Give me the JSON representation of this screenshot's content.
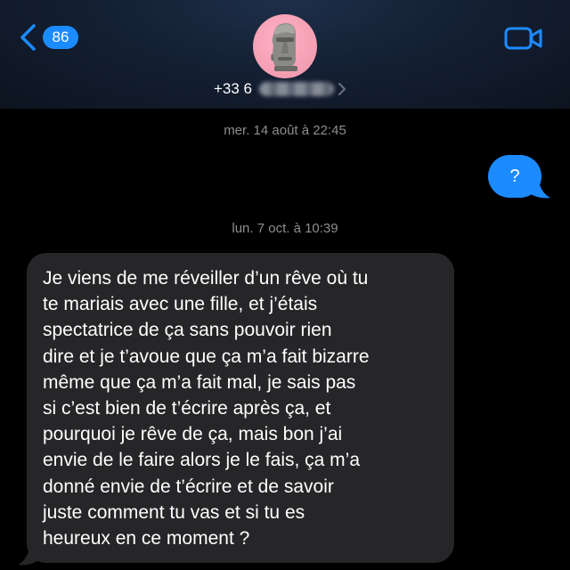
{
  "header": {
    "back_count": "86",
    "contact_number_prefix": "+33 6",
    "avatar": "moai-emoji-avatar",
    "video_icon": "video-camera-icon",
    "colors": {
      "accent": "#1c8bff",
      "header_bg": "#142033",
      "avatar_bg": "#f5a0b4"
    }
  },
  "conversation": {
    "timestamp_1": "mer. 14 août à 22:45",
    "sent_message": "?",
    "timestamp_2": "lun. 7 oct. à 10:39",
    "received_lines": [
      "Je viens de me réveiller d’un rêve où tu",
      "te mariais avec une fille, et j’étais",
      "spectatrice de ça sans pouvoir rien",
      "dire et je t’avoue que ça m’a fait bizarre",
      "même que ça m’a fait mal, je sais pas",
      "si c’est bien de t’écrire après ça, et",
      "pourquoi je rêve de ça, mais bon j’ai",
      "envie de le faire alors je le fais, ça m’a",
      "donné envie de t’écrire et de savoir",
      "juste comment tu vas et si tu es",
      "heureux en ce moment ?"
    ],
    "colors": {
      "sent_bubble": "#1c8bff",
      "received_bubble": "#262629",
      "timestamp_text": "#8e8e93"
    }
  }
}
